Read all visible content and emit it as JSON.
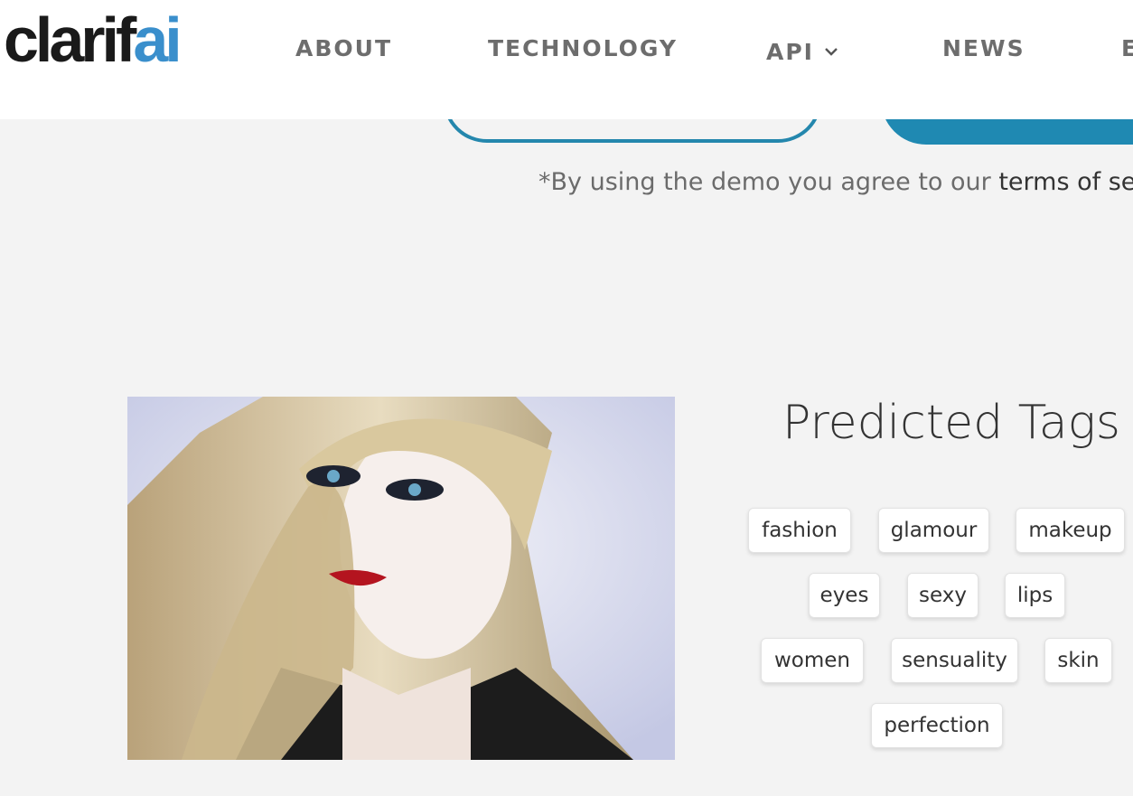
{
  "header": {
    "logo_text_dark": "clarif",
    "logo_text_blue": "ai",
    "nav": [
      {
        "label": "ABOUT"
      },
      {
        "label": "TECHNOLOGY"
      },
      {
        "label": "API"
      },
      {
        "label": "NEWS"
      },
      {
        "label": "E"
      }
    ]
  },
  "demo": {
    "terms_prefix": "*By using the demo you agree to our ",
    "terms_link": "terms of serv"
  },
  "results": {
    "title": "Predicted Tags",
    "tags": [
      "fashion",
      "glamour",
      "makeup",
      "eyes",
      "sexy",
      "lips",
      "women",
      "sensuality",
      "skin",
      "perfection"
    ]
  },
  "colors": {
    "brand_blue": "#3a8fcc",
    "button_blue": "#1f89b2",
    "page_bg": "#f3f3f3"
  }
}
